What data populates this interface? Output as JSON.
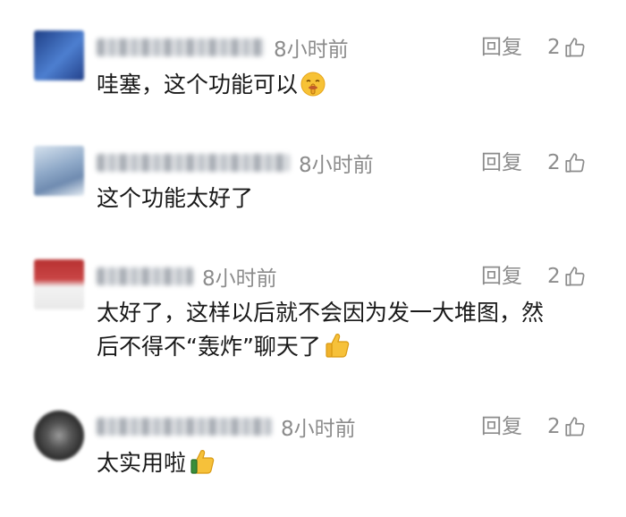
{
  "comments": [
    {
      "time": "8小时前",
      "reply_label": "回复",
      "likes": "2",
      "text": "哇塞，这个功能可以",
      "emoji": "shush-face-emoji",
      "avatar_colors": [
        "#1f3f86",
        "#4d7fd0"
      ]
    },
    {
      "time": "8小时前",
      "reply_label": "回复",
      "likes": "2",
      "text": "这个功能太好了",
      "emoji": "",
      "avatar_colors": [
        "#6f8bb0",
        "#d6e2ee"
      ]
    },
    {
      "time": "8小时前",
      "reply_label": "回复",
      "likes": "2",
      "text_line1": "太好了，这样以后就不会因为发一大堆图，然",
      "text_line2": "后不得不“轰炸”聊天了",
      "emoji": "thumbs-up-emoji",
      "avatar_colors": [
        "#b83232",
        "#f2f2f2"
      ]
    },
    {
      "time": "8小时前",
      "reply_label": "回复",
      "likes": "2",
      "text": "太实用啦",
      "emoji": "thumbs-up-emoji",
      "avatar_colors": [
        "#2b2b2b",
        "#9a9a9a"
      ]
    }
  ]
}
